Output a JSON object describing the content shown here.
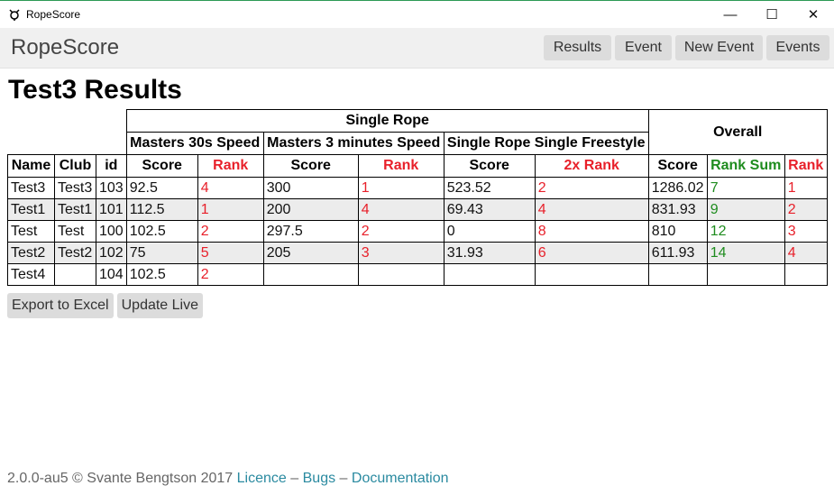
{
  "window": {
    "title": "RopeScore",
    "minimize": "—",
    "maximize": "☐",
    "close": "✕"
  },
  "navbar": {
    "brand": "RopeScore",
    "buttons": [
      "Results",
      "Event",
      "New Event",
      "Events"
    ]
  },
  "page_title": "Test3 Results",
  "table": {
    "group_header": "Single Rope",
    "overall_header": "Overall",
    "event_headers": [
      "Masters 30s Speed",
      "Masters 3 minutes Speed",
      "Single Rope Single Freestyle"
    ],
    "columns": [
      "Name",
      "Club",
      "id",
      "Score",
      "Rank",
      "Score",
      "Rank",
      "Score",
      "2x Rank",
      "Score",
      "Rank Sum",
      "Rank"
    ],
    "rows": [
      [
        "Test3",
        "Test3",
        "103",
        "92.5",
        "4",
        "300",
        "1",
        "523.52",
        "2",
        "1286.02",
        "7",
        "1"
      ],
      [
        "Test1",
        "Test1",
        "101",
        "112.5",
        "1",
        "200",
        "4",
        "69.43",
        "4",
        "831.93",
        "9",
        "2"
      ],
      [
        "Test",
        "Test",
        "100",
        "102.5",
        "2",
        "297.5",
        "2",
        "0",
        "8",
        "810",
        "12",
        "3"
      ],
      [
        "Test2",
        "Test2",
        "102",
        "75",
        "5",
        "205",
        "3",
        "31.93",
        "6",
        "611.93",
        "14",
        "4"
      ],
      [
        "Test4",
        "",
        "104",
        "102.5",
        "2",
        "",
        "",
        "",
        "",
        "",
        "",
        ""
      ]
    ]
  },
  "actions": {
    "export": "Export to Excel",
    "update": "Update Live"
  },
  "footer": {
    "text": "2.0.0-au5 © Svante Bengtson 2017",
    "licence": "Licence",
    "sep1": "–",
    "bugs": "Bugs",
    "sep2": "–",
    "documentation": "Documentation"
  },
  "colors": {
    "rank_red": "#e8202a",
    "rank_sum_green": "#1e8c1e",
    "row_alt": "#ececec",
    "link": "#2a8aa0"
  }
}
